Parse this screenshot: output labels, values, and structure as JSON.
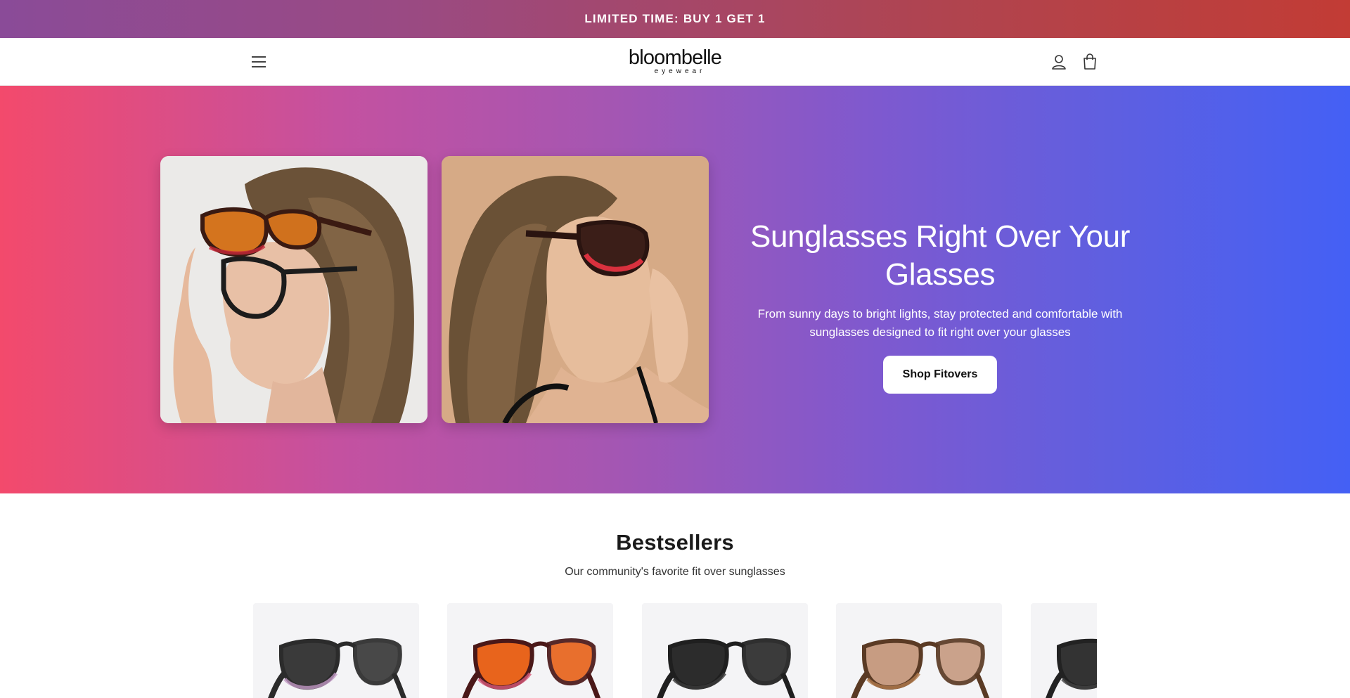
{
  "announcement": {
    "text": "LIMITED TIME: BUY 1 GET 1"
  },
  "header": {
    "logo_main": "bloombelle",
    "logo_sub": "eyewear",
    "menu_icon": "hamburger-menu-icon",
    "account_icon": "user-icon",
    "cart_icon": "shopping-bag-icon"
  },
  "hero": {
    "title": "Sunglasses Right Over Your Glasses",
    "text": "From sunny days to bright lights, stay protected and comfortable with sunglasses designed to fit right over your glasses",
    "cta_label": "Shop Fitovers",
    "colors": {
      "start": "#f34a6c",
      "mid": "#a556b2",
      "end": "#4460f5"
    }
  },
  "bestsellers": {
    "title": "Bestsellers",
    "subtitle": "Our community's favorite fit over sunglasses",
    "products": [
      {
        "frame_color": "#2b2b2b",
        "accent": "#c39ac6",
        "lens_color": "#3a3a3a"
      },
      {
        "frame_color": "#4a1818",
        "accent": "#d65a7a",
        "lens_color": "#e8641c"
      },
      {
        "frame_color": "#1f1f1f",
        "accent": "#3a3a3a",
        "lens_color": "#2c2c2c"
      },
      {
        "frame_color": "#5a3a24",
        "accent": "#b07a4c",
        "lens_color": "#c79c82"
      },
      {
        "frame_color": "#222222",
        "accent": "#444444",
        "lens_color": "#333333"
      }
    ]
  }
}
